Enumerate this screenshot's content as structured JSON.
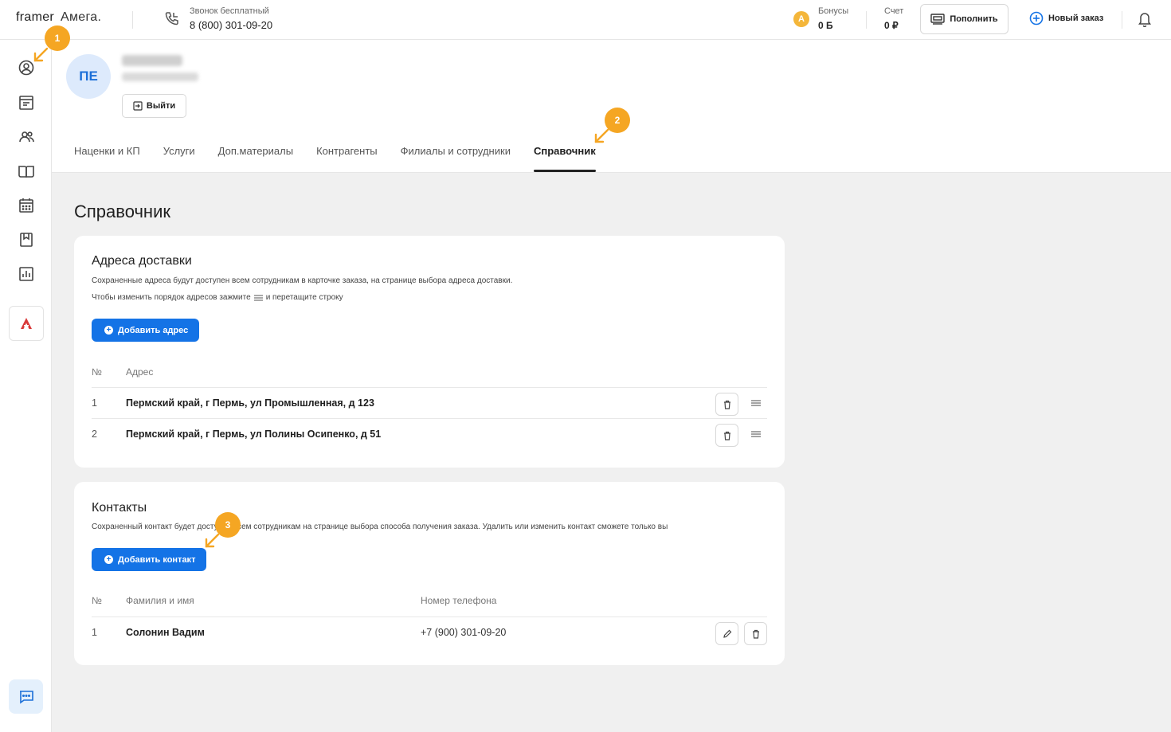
{
  "header": {
    "logo_primary": "framer",
    "logo_secondary": "Амега.",
    "phone_caption": "Звонок бесплатный",
    "phone_number": "8 (800) 301-09-20",
    "bonus_coin": "A",
    "bonus_label": "Бонусы",
    "bonus_value": "0 Б",
    "account_label": "Счет",
    "account_value": "0 ₽",
    "topup_label": "Пополнить",
    "new_order_label": "Новый заказ"
  },
  "sidebar": {
    "items": [
      "profile-icon",
      "orders-icon",
      "users-icon",
      "catalog-icon",
      "calendar-icon",
      "bookmark-icon",
      "stats-icon"
    ],
    "brand_letter": "A"
  },
  "profile": {
    "initials": "ПЕ",
    "logout_label": "Выйти",
    "tabs": [
      {
        "label": "Наценки и КП",
        "active": false
      },
      {
        "label": "Услуги",
        "active": false
      },
      {
        "label": "Доп.материалы",
        "active": false
      },
      {
        "label": "Контрагенты",
        "active": false
      },
      {
        "label": "Филиалы и сотрудники",
        "active": false
      },
      {
        "label": "Справочник",
        "active": true
      }
    ]
  },
  "main": {
    "title": "Справочник",
    "addresses": {
      "title": "Адреса доставки",
      "note1": "Сохраненные адреса будут доступен всем сотрудникам в карточке заказа, на странице выбора адреса доставки.",
      "note2_before": "Чтобы изменить порядок адресов зажмите",
      "note2_after": "и перетащите строку",
      "add_label": "Добавить адрес",
      "col_num": "№",
      "col_address": "Адрес",
      "rows": [
        {
          "num": "1",
          "address": "Пермский край, г Пермь, ул Промышленная, д 123"
        },
        {
          "num": "2",
          "address": "Пермский край, г Пермь, ул Полины Осипенко, д 51"
        }
      ]
    },
    "contacts": {
      "title": "Контакты",
      "note": "Сохраненный контакт будет доступен всем сотрудникам на странице выбора способа получения заказа. Удалить или изменить контакт сможете только вы",
      "add_label": "Добавить контакт",
      "col_num": "№",
      "col_name": "Фамилия и имя",
      "col_phone": "Номер телефона",
      "rows": [
        {
          "num": "1",
          "name": "Солонин Вадим",
          "phone": "+7 (900) 301-09-20"
        }
      ]
    }
  },
  "annotations": [
    "1",
    "2",
    "3"
  ],
  "colors": {
    "accent": "#1473e6",
    "badge": "#f5a623",
    "avatar_bg": "#ddeafc"
  }
}
